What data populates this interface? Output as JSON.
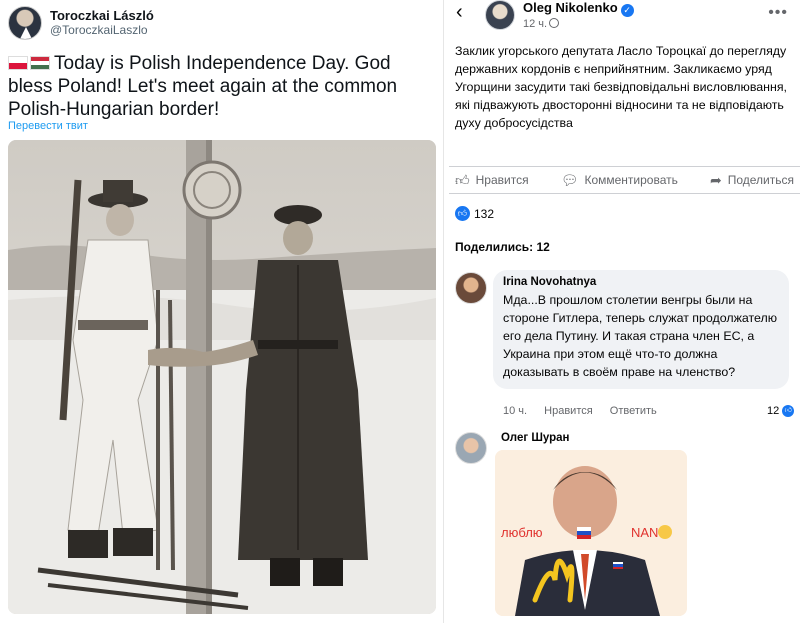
{
  "tweet": {
    "display_name": "Toroczkai László",
    "handle": "@ToroczkaiLaszlo",
    "text": "Today is Polish Independence Day. God bless Poland! Let's meet again at the common Polish-Hungarian border!",
    "translate_link": "Перевести твит"
  },
  "facebook_post": {
    "author": "Oleg Nikolenko",
    "time": "12 ч.",
    "body": "Заклик угорського депутата Ласло Тороцкаї до перегляду державних кордонів є неприйнятним. Закликаємо уряд Угорщини засудити такі безвідповідальні висловлювання, які підважують двосторонні відносини та не відповідають духу добросусідства",
    "actions": {
      "like": "Нравится",
      "comment": "Комментировать",
      "share": "Поделиться"
    },
    "reactions_count": "132",
    "shares": "Поделились: 12",
    "comments": [
      {
        "author": "Irina Novohatnya",
        "text": "Мда...В прошлом столетии венгры были на стороне Гитлера, теперь служат продолжателю его дела Путину. И такая страна член ЕС, а Украина при этом ещё что-то должна доказывать в своём праве на членство?",
        "time": "10 ч.",
        "reply_like": "Нравится",
        "reply": "Ответить",
        "likes": "12"
      },
      {
        "author": "Олег Шуран",
        "meme_caption_left": "люблю",
        "meme_caption_right": "NAN"
      }
    ]
  },
  "colors": {
    "twitter_blue": "#1d9bf0",
    "facebook_blue": "#1877f2",
    "comment_bubble": "#f0f2f5"
  },
  "icons": {
    "back": "back-arrow-icon",
    "verified": "verified-badge-icon",
    "like": "thumbs-up-icon",
    "comment": "comment-bubble-icon",
    "share": "share-arrow-icon",
    "more": "more-dots-icon"
  }
}
